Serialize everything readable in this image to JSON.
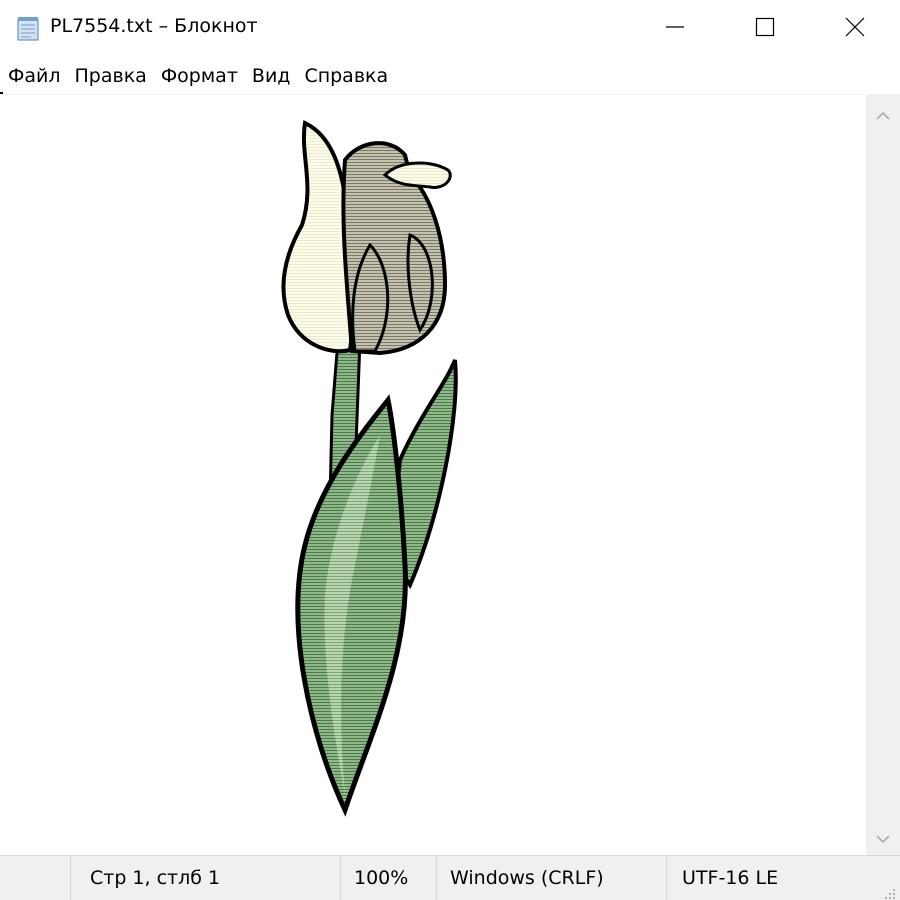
{
  "window": {
    "title": "PL7554.txt – Блокнот"
  },
  "menu": {
    "items": [
      "Файл",
      "Правка",
      "Формат",
      "Вид",
      "Справка"
    ]
  },
  "editor": {
    "content_description_icon": "tulip-ascii-art"
  },
  "statusbar": {
    "position": "Стр 1, стлб 1",
    "zoom": "100%",
    "line_ending": "Windows (CRLF)",
    "encoding": "UTF-16 LE"
  },
  "colors": {
    "petal_light": "#fdfce8",
    "petal_dark": "#b9b8a4",
    "leaf_green": "#8fb88a",
    "outline": "#000000",
    "statusbar_bg": "#f0f0f0"
  }
}
